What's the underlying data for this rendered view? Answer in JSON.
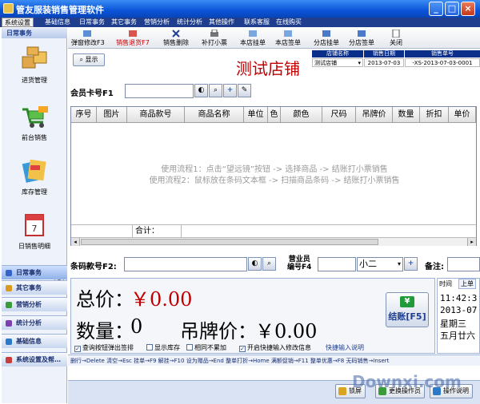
{
  "window": {
    "title": "管友服装销售管理软件"
  },
  "menu": [
    "系统设置",
    "基础信息",
    "日常事务",
    "其它事务",
    "营销分析",
    "统计分析",
    "其他操作",
    "联系客服",
    "在线购买"
  ],
  "left_panel": {
    "header": "日常事务",
    "items": [
      {
        "label": "进货管理",
        "icon": "boxes-icon"
      },
      {
        "label": "前台销售",
        "icon": "cart-icon"
      },
      {
        "label": "库存管理",
        "icon": "stock-icon"
      },
      {
        "label": "日销售明细",
        "icon": "calendar-icon"
      }
    ],
    "sections": [
      {
        "label": "日常事务",
        "color": "#3463c9"
      },
      {
        "label": "其它事务",
        "color": "#d99a1e"
      },
      {
        "label": "营销分析",
        "color": "#3a9b3a"
      },
      {
        "label": "统计分析",
        "color": "#7e3fb0"
      },
      {
        "label": "基础信息",
        "color": "#2b7ac9"
      },
      {
        "label": "系统设置及帮…",
        "color": "#c83b3b"
      }
    ]
  },
  "toolbar": [
    {
      "label": "弹窗修改F3",
      "icon": "edit-icon",
      "red": false
    },
    {
      "label": "销售退货F7",
      "icon": "return-icon",
      "red": true
    },
    {
      "label": "销售删除",
      "icon": "delete-icon",
      "red": false
    },
    {
      "label": "补打小票",
      "icon": "print-icon",
      "red": false
    },
    {
      "label": "本店挂单",
      "icon": "hold-icon",
      "red": false
    },
    {
      "label": "本店签单",
      "icon": "sign-icon",
      "red": false
    },
    {
      "label": "分店挂单",
      "icon": "branch-hold-icon",
      "red": false
    },
    {
      "label": "分店签单",
      "icon": "branch-sign-icon",
      "red": false
    },
    {
      "label": "关闭",
      "icon": "close-doc-icon",
      "red": false
    }
  ],
  "header": {
    "display_button": "显示",
    "store_title": "测试店铺",
    "info_headers": [
      "店铺名称",
      "销售日期",
      "销售单号"
    ],
    "info_values": [
      "测试店铺",
      "2013-07-03",
      "-XS-2013-07-03-0001"
    ],
    "member_label": "会员卡号F1"
  },
  "grid": {
    "columns": [
      "序号",
      "图片",
      "商品款号",
      "商品名称",
      "单位",
      "色",
      "颜色",
      "尺码",
      "吊牌价",
      "数量",
      "折扣",
      "单价"
    ],
    "hint1": "使用流程1：点击“望远镜”按钮 -> 选择商品 -> 结账打小票销售",
    "hint2": "使用流程2：鼠标放在条码文本框 -> 扫描商品条码 -> 结账打小票销售",
    "sum_label": "合计："
  },
  "barcode": {
    "label": "条码款号F2:",
    "salesperson_label1": "营业员",
    "salesperson_label2": "编号F4",
    "salesperson_value": "小二",
    "remark_label": "备注:"
  },
  "summary": {
    "total_label": "总价：",
    "total_value": "￥0.00",
    "qty_label": "数量：",
    "qty_value": "0",
    "tag_label": "吊牌价：",
    "tag_value": "￥0.00",
    "pay_label": "结账[F5]",
    "options": [
      {
        "label": "查询按钮弹出签排",
        "checked": true
      },
      {
        "label": "显示库存",
        "checked": false
      },
      {
        "label": "相同不累加",
        "checked": false
      },
      {
        "label": "开启快捷输入修改信息",
        "checked": true
      }
    ],
    "quick_help": "快捷输入说明"
  },
  "time_panel": {
    "tabs": [
      "时间",
      "上单"
    ],
    "time": "11:42:3",
    "date": "2013-07",
    "weekday": "星期三",
    "lunar": "五月廿六"
  },
  "shortcuts": "删行→Delete  清空→Esc    挂单→F9  解挂→F10    设为赠品→End  整单打折→Home  满额促销→F11  整单优惠→F8    无码销售→Insert",
  "status": {
    "lock": "锁屏",
    "switch_user": "更换操作员",
    "help": "操作说明"
  },
  "watermark": "Downxi.com"
}
